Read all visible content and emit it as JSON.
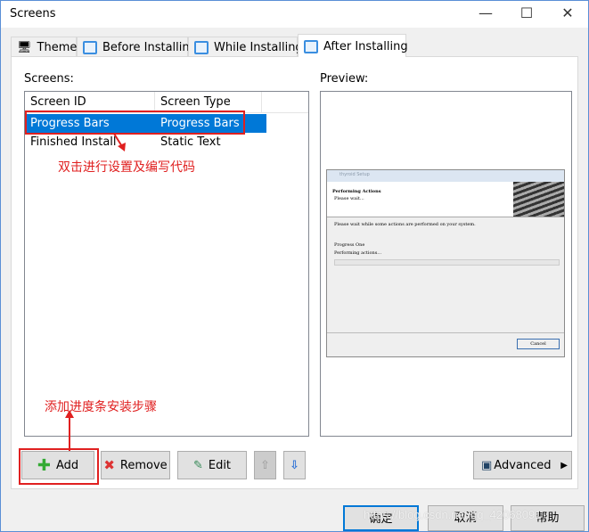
{
  "window": {
    "title": "Screens"
  },
  "tabs": [
    {
      "label": "Theme"
    },
    {
      "label": "Before Installing"
    },
    {
      "label": "While Installing"
    },
    {
      "label": "After Installing",
      "active": true
    }
  ],
  "screens": {
    "label": "Screens:",
    "columns": [
      "Screen ID",
      "Screen Type"
    ],
    "rows": [
      {
        "id": "Progress Bars",
        "type": "Progress Bars",
        "selected": true
      },
      {
        "id": "Finished Install",
        "type": "Static Text"
      }
    ]
  },
  "preview": {
    "label": "Preview:",
    "mini": {
      "title": "thyroid Setup",
      "heading": "Performing Actions",
      "subheading": "Please wait...",
      "body": "Please wait while some actions are performed on your system.",
      "progress_title": "Progress One",
      "progress_status": "Performing actions...",
      "progress": 0,
      "cancel": "Cancel"
    }
  },
  "annotations": {
    "edit_note": "双击进行设置及编写代码",
    "add_note": "添加进度条安装步骤"
  },
  "buttons": {
    "add": "Add",
    "remove": "Remove",
    "edit": "Edit",
    "advanced": "Advanced"
  },
  "footer": {
    "ok": "确定",
    "cancel": "取消",
    "help": "帮助"
  },
  "watermark": "https://blog.csdn.net/qq_42068091",
  "colors": {
    "selection": "#0078d7",
    "annotation": "#e02020"
  }
}
